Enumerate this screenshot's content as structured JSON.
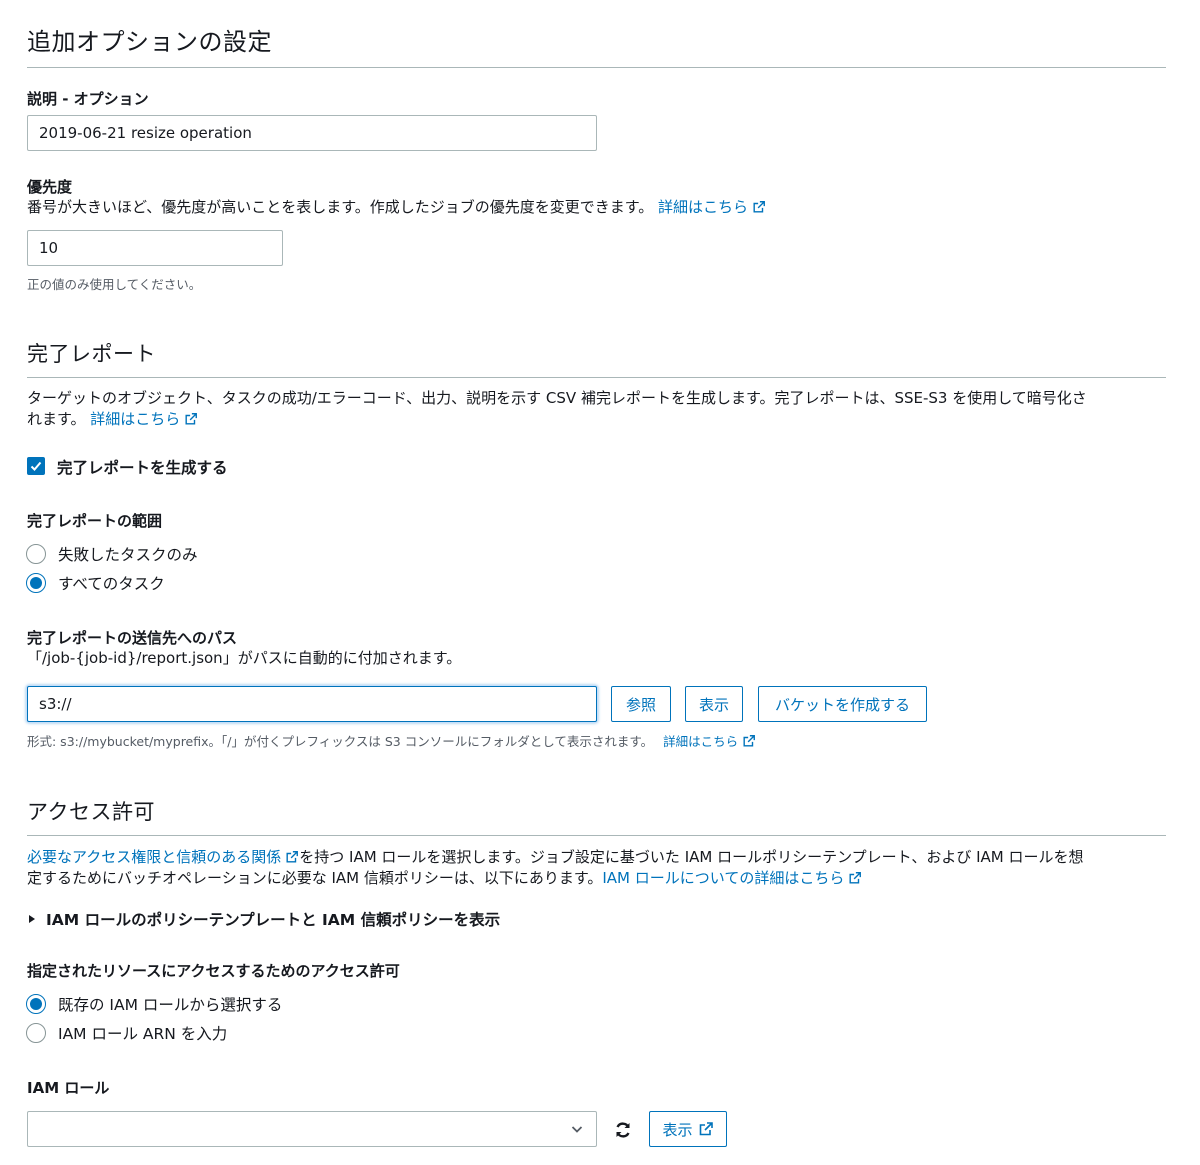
{
  "page": {
    "title": "追加オプションの設定"
  },
  "description": {
    "label": "説明 - オプション",
    "value": "2019-06-21 resize operation"
  },
  "priority": {
    "label": "優先度",
    "help": "番号が大きいほど、優先度が高いことを表します。作成したジョブの優先度を変更できます。",
    "link": "詳細はこちら",
    "value": "10",
    "hint": "正の値のみ使用してください。"
  },
  "completion_report": {
    "title": "完了レポート",
    "desc_line1": "ターゲットのオブジェクト、タスクの成功/エラーコード、出力、説明を示す CSV 補完レポートを生成します。完了レポートは、SSE-S3 を使用して暗号化さ",
    "desc_line2": "れます。",
    "link": "詳細はこちら",
    "generate_label": "完了レポートを生成する",
    "generate_checked": true,
    "scope_label": "完了レポートの範囲",
    "scope_options": [
      {
        "label": "失敗したタスクのみ",
        "selected": false
      },
      {
        "label": "すべてのタスク",
        "selected": true
      }
    ],
    "path_label": "完了レポートの送信先へのパス",
    "path_help": "「/job-{job-id}/report.json」がパスに自動的に付加されます。",
    "path_value": "s3://",
    "browse_button": "参照",
    "view_button": "表示",
    "create_bucket_button": "バケットを作成する",
    "format_hint": "形式: s3://mybucket/myprefix。「/」が付くプレフィックスは S3 コンソールにフォルダとして表示されます。",
    "format_link": "詳細はこちら"
  },
  "access": {
    "title": "アクセス許可",
    "link1": "必要なアクセス権限と信頼のある関係",
    "desc_part1": "を持つ IAM ロールを選択します。ジョブ設定に基づいた IAM ロールポリシーテンプレート、および IAM ロールを想",
    "desc_part2": "定するためにバッチオペレーションに必要な IAM 信頼ポリシーは、以下にあります。",
    "link2": "IAM ロールについての詳細はこちら",
    "expander_label": "IAM ロールのポリシーテンプレートと IAM 信頼ポリシーを表示",
    "resource_label": "指定されたリソースにアクセスするためのアクセス許可",
    "resource_options": [
      {
        "label": "既存の IAM ロールから選択する",
        "selected": true
      },
      {
        "label": "IAM ロール ARN を入力",
        "selected": false
      }
    ],
    "iam_role_label": "IAM ロール",
    "iam_role_value": "",
    "view_button": "表示"
  },
  "colors": {
    "link": "#0073bb",
    "text": "#16191f",
    "muted": "#545b64",
    "border": "#aab7b8"
  }
}
